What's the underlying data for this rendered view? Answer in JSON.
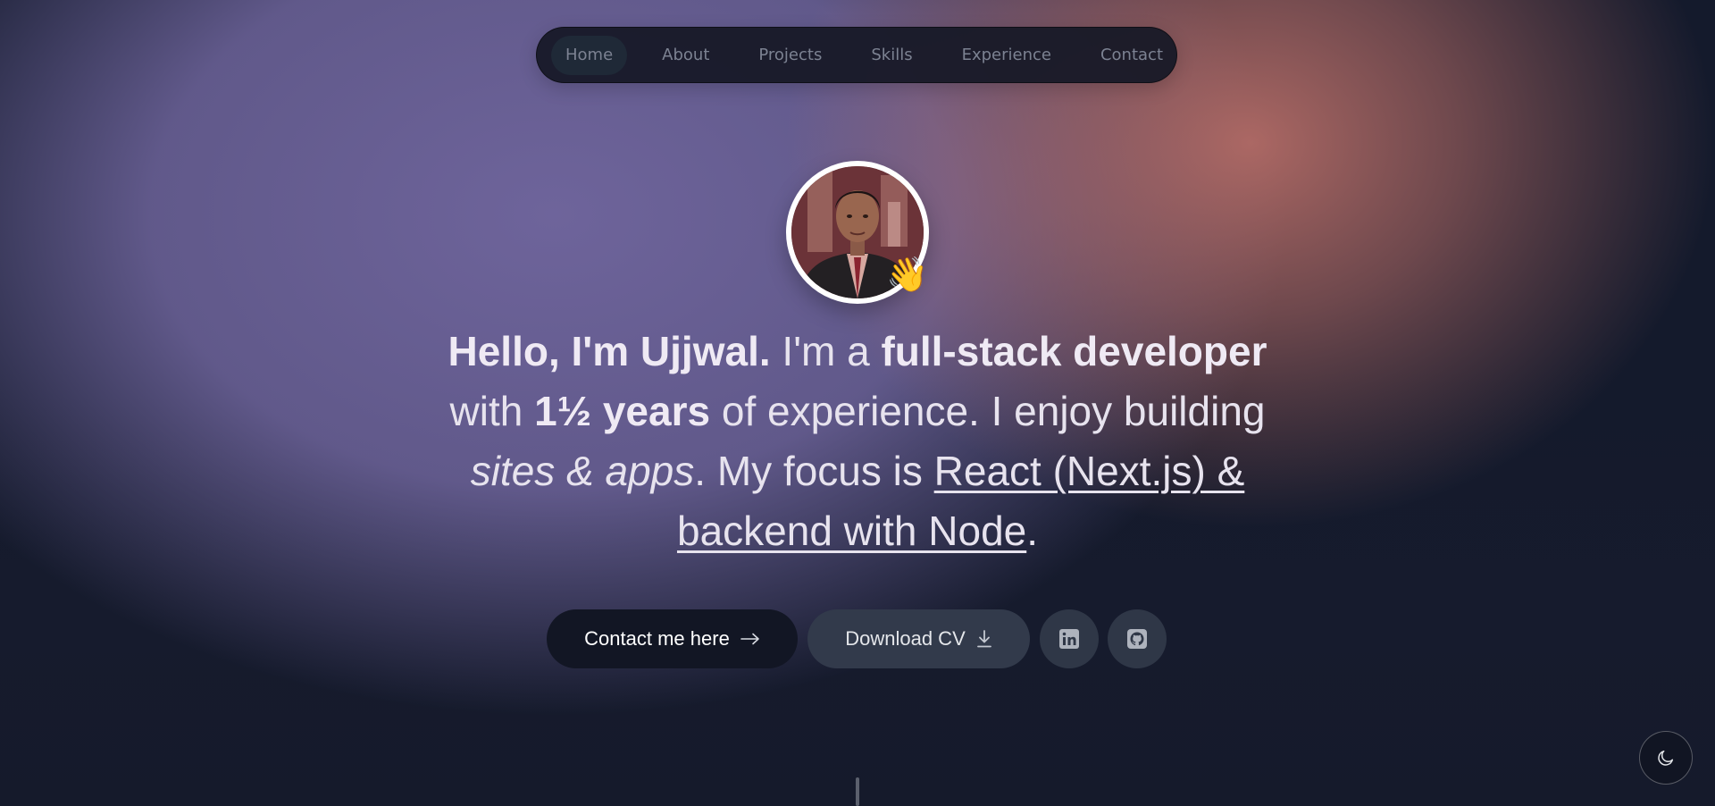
{
  "nav": {
    "items": [
      {
        "label": "Home",
        "active": true
      },
      {
        "label": "About"
      },
      {
        "label": "Projects"
      },
      {
        "label": "Skills"
      },
      {
        "label": "Experience"
      },
      {
        "label": "Contact"
      }
    ]
  },
  "hero": {
    "avatar_icon": "profile-photo",
    "wave_emoji": "👋",
    "headline": {
      "p1": "Hello, I'm Ujjwal.",
      "p2": " I'm a ",
      "p3": "full-stack developer",
      "p4": " with ",
      "p5": "1½ years",
      "p6": " of experience. I enjoy building ",
      "p7": "sites & apps",
      "p8": ". My focus is ",
      "p9": "React (Next.js) & backend with Node",
      "p10": "."
    }
  },
  "actions": {
    "contact_label": "Contact me here",
    "contact_icon": "arrow-right-icon",
    "cv_label": "Download CV",
    "cv_icon": "download-icon",
    "linkedin_icon": "linkedin-icon",
    "github_icon": "github-icon"
  },
  "theme_toggle": {
    "icon": "moon-icon"
  },
  "colors": {
    "accent_purple": "#6e649b",
    "accent_rose": "#b86e68",
    "background": "#141a2c"
  }
}
